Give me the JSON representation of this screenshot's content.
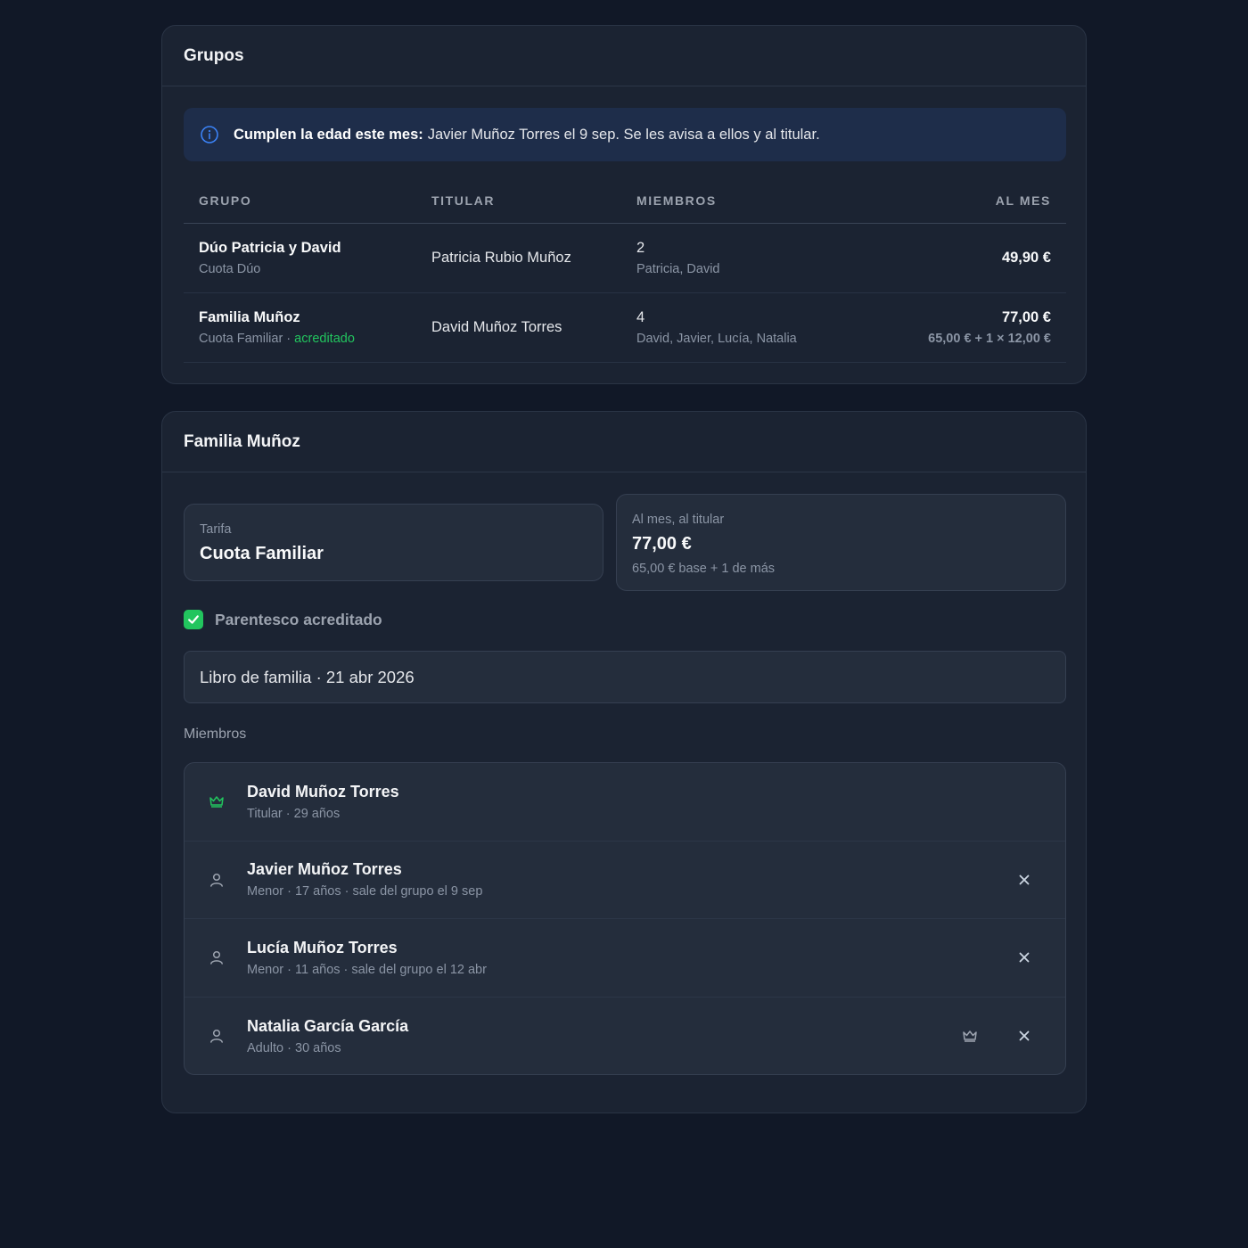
{
  "groups_card": {
    "title": "Grupos",
    "banner": {
      "icon": "info-icon",
      "bold": "Cumplen la edad este mes:",
      "text": "Javier Muñoz Torres el 9 sep. Se les avisa a ellos y al titular."
    },
    "columns": [
      "GRUPO",
      "TITULAR",
      "MIEMBROS",
      "AL MES"
    ],
    "rows": [
      {
        "name": "Dúo Patricia y David",
        "plan": "Cuota Dúo",
        "plan_sep": "",
        "plan_status": "",
        "holder": "Patricia Rubio Muñoz",
        "members_count": "2",
        "members_names": "Patricia, David",
        "monthly": "49,90 €",
        "monthly_detail": ""
      },
      {
        "name": "Familia Muñoz",
        "plan": "Cuota Familiar",
        "plan_sep": " · ",
        "plan_status": "acreditado",
        "holder": "David Muñoz Torres",
        "members_count": "4",
        "members_names": "David, Javier, Lucía, Natalia",
        "monthly": "77,00 €",
        "monthly_detail": "65,00 € + 1 × 12,00 €"
      }
    ]
  },
  "family_card": {
    "title": "Familia Muñoz",
    "tarifa": {
      "label": "Tarifa",
      "value": "Cuota Familiar"
    },
    "monthly": {
      "label": "Al mes, al titular",
      "value": "77,00 €",
      "detail": "65,00 € base + 1 de más"
    },
    "kinship": {
      "label": "Parentesco acreditado",
      "checked": true
    },
    "document": "Libro de familia · 21 abr 2026",
    "members_label": "Miembros",
    "members": [
      {
        "name": "David Muñoz Torres",
        "detail": "Titular · 29 años",
        "icon": "crown-icon",
        "removable": false,
        "make_holder": false
      },
      {
        "name": "Javier Muñoz Torres",
        "detail": "Menor · 17 años · sale del grupo el 9 sep",
        "icon": "user-icon",
        "removable": true,
        "make_holder": false
      },
      {
        "name": "Lucía Muñoz Torres",
        "detail": "Menor · 11 años · sale del grupo el 12 abr",
        "icon": "user-icon",
        "removable": true,
        "make_holder": false
      },
      {
        "name": "Natalia García García",
        "detail": "Adulto · 30 años",
        "icon": "user-icon",
        "removable": true,
        "make_holder": true
      }
    ]
  },
  "colors": {
    "background": "#111827",
    "card": "#1b2332",
    "accent_green": "#22c55e",
    "info_blue": "#3b82f6"
  }
}
